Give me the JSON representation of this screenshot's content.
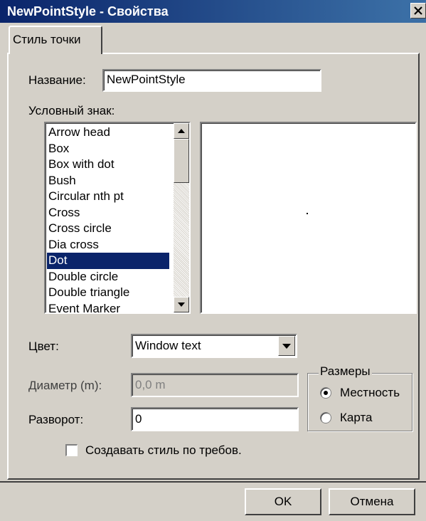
{
  "window": {
    "title": "NewPointStyle - Свойства"
  },
  "tabs": [
    {
      "label": "Стиль точки",
      "active": true
    }
  ],
  "name_field": {
    "label": "Название:",
    "value": "NewPointStyle"
  },
  "symbol": {
    "label": "Условный знак:",
    "items": [
      "Arrow head",
      "Box",
      "Box with dot",
      "Bush",
      "Circular nth pt",
      "Cross",
      "Cross circle",
      "Dia cross",
      "Dot",
      "Double circle",
      "Double triangle",
      "Event Marker"
    ],
    "selected": "Dot"
  },
  "color_field": {
    "label": "Цвет:",
    "value": "Window text"
  },
  "diameter_field": {
    "label": "Диаметр (m):",
    "value": "0,0 m",
    "disabled": true
  },
  "rotation_field": {
    "label": "Разворот:",
    "value": "0"
  },
  "sizes_group": {
    "title": "Размеры",
    "options": [
      "Местность",
      "Карта"
    ],
    "selected": "Местность"
  },
  "create_on_demand": {
    "label": "Создавать стиль по требов.",
    "checked": false
  },
  "buttons": {
    "ok": "OK",
    "cancel": "Отмена"
  },
  "colors": {
    "title_bar": "#0a246a",
    "face": "#d4d0c8",
    "selection": "#0a246a"
  }
}
